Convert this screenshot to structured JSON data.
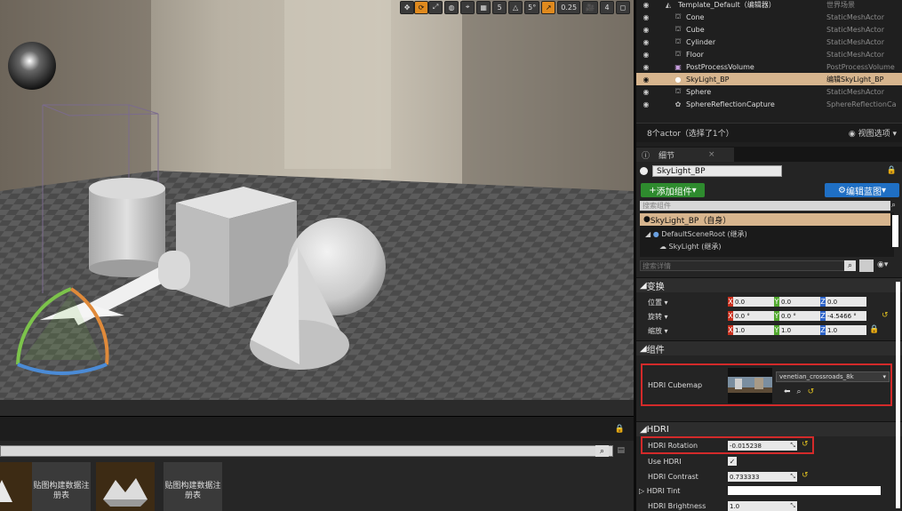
{
  "viewport": {
    "toolbar": {
      "grid_snap": "5",
      "rot_snap": "5°",
      "scale_snap": "0.25",
      "cam_speed": "4"
    }
  },
  "content_browser": {
    "assets": [
      {
        "label": "贴图构建数据注册表"
      },
      {
        "label": "贴图构建数据注册表"
      }
    ]
  },
  "outliner": {
    "rows": [
      {
        "name": "Template_Default（编辑器）",
        "type": "世界场景",
        "icon": "world-icon",
        "selected": false
      },
      {
        "name": "Cone",
        "type": "StaticMeshActor",
        "icon": "static-mesh-icon",
        "selected": false
      },
      {
        "name": "Cube",
        "type": "StaticMeshActor",
        "icon": "static-mesh-icon",
        "selected": false
      },
      {
        "name": "Cylinder",
        "type": "StaticMeshActor",
        "icon": "static-mesh-icon",
        "selected": false
      },
      {
        "name": "Floor",
        "type": "StaticMeshActor",
        "icon": "static-mesh-icon",
        "selected": false
      },
      {
        "name": "PostProcessVolume",
        "type": "PostProcessVolume",
        "icon": "post-process-icon",
        "selected": false
      },
      {
        "name": "SkyLight_BP",
        "type": "编辑SkyLight_BP",
        "icon": "skylight-icon",
        "selected": true
      },
      {
        "name": "Sphere",
        "type": "StaticMeshActor",
        "icon": "static-mesh-icon",
        "selected": false
      },
      {
        "name": "SphereReflectionCapture",
        "type": "SphereReflectionCa",
        "icon": "reflection-capture-icon",
        "selected": false
      }
    ],
    "count": "8个actor（选择了1个）",
    "view_options": "视图选项"
  },
  "details": {
    "tab": "细节",
    "actor_name": "SkyLight_BP",
    "add_component": "添加组件",
    "edit_blueprint": "编辑蓝图",
    "search_components_placeholder": "搜索组件",
    "self_item": "SkyLight_BP（自身）",
    "root_item": "DefaultSceneRoot (继承)",
    "sky_item": "SkyLight (继承)",
    "search_details_placeholder": "搜索详情",
    "transform": {
      "section": "变换",
      "location_label": "位置",
      "rotation_label": "旋转",
      "scale_label": "缩放",
      "location": [
        "0.0",
        "0.0",
        "0.0"
      ],
      "rotation": [
        "0.0 °",
        "0.0 °",
        "-4.5466 °"
      ],
      "scale": [
        "1.0",
        "1.0",
        "1.0"
      ]
    },
    "components_section": "组件",
    "hdri_cubemap_label": "HDRI Cubemap",
    "hdri_cubemap_value": "venetian_crossroads_8k",
    "hdri_section": "HDRI",
    "hdri_rotation_label": "HDRI Rotation",
    "hdri_rotation_value": "-0.015238",
    "use_hdri_label": "Use HDRI",
    "hdri_contrast_label": "HDRI Contrast",
    "hdri_contrast_value": "0.733333",
    "hdri_tint_label": "HDRI Tint",
    "hdri_brightness_label": "HDRI Brightness",
    "hdri_brightness_value": "1.0"
  }
}
